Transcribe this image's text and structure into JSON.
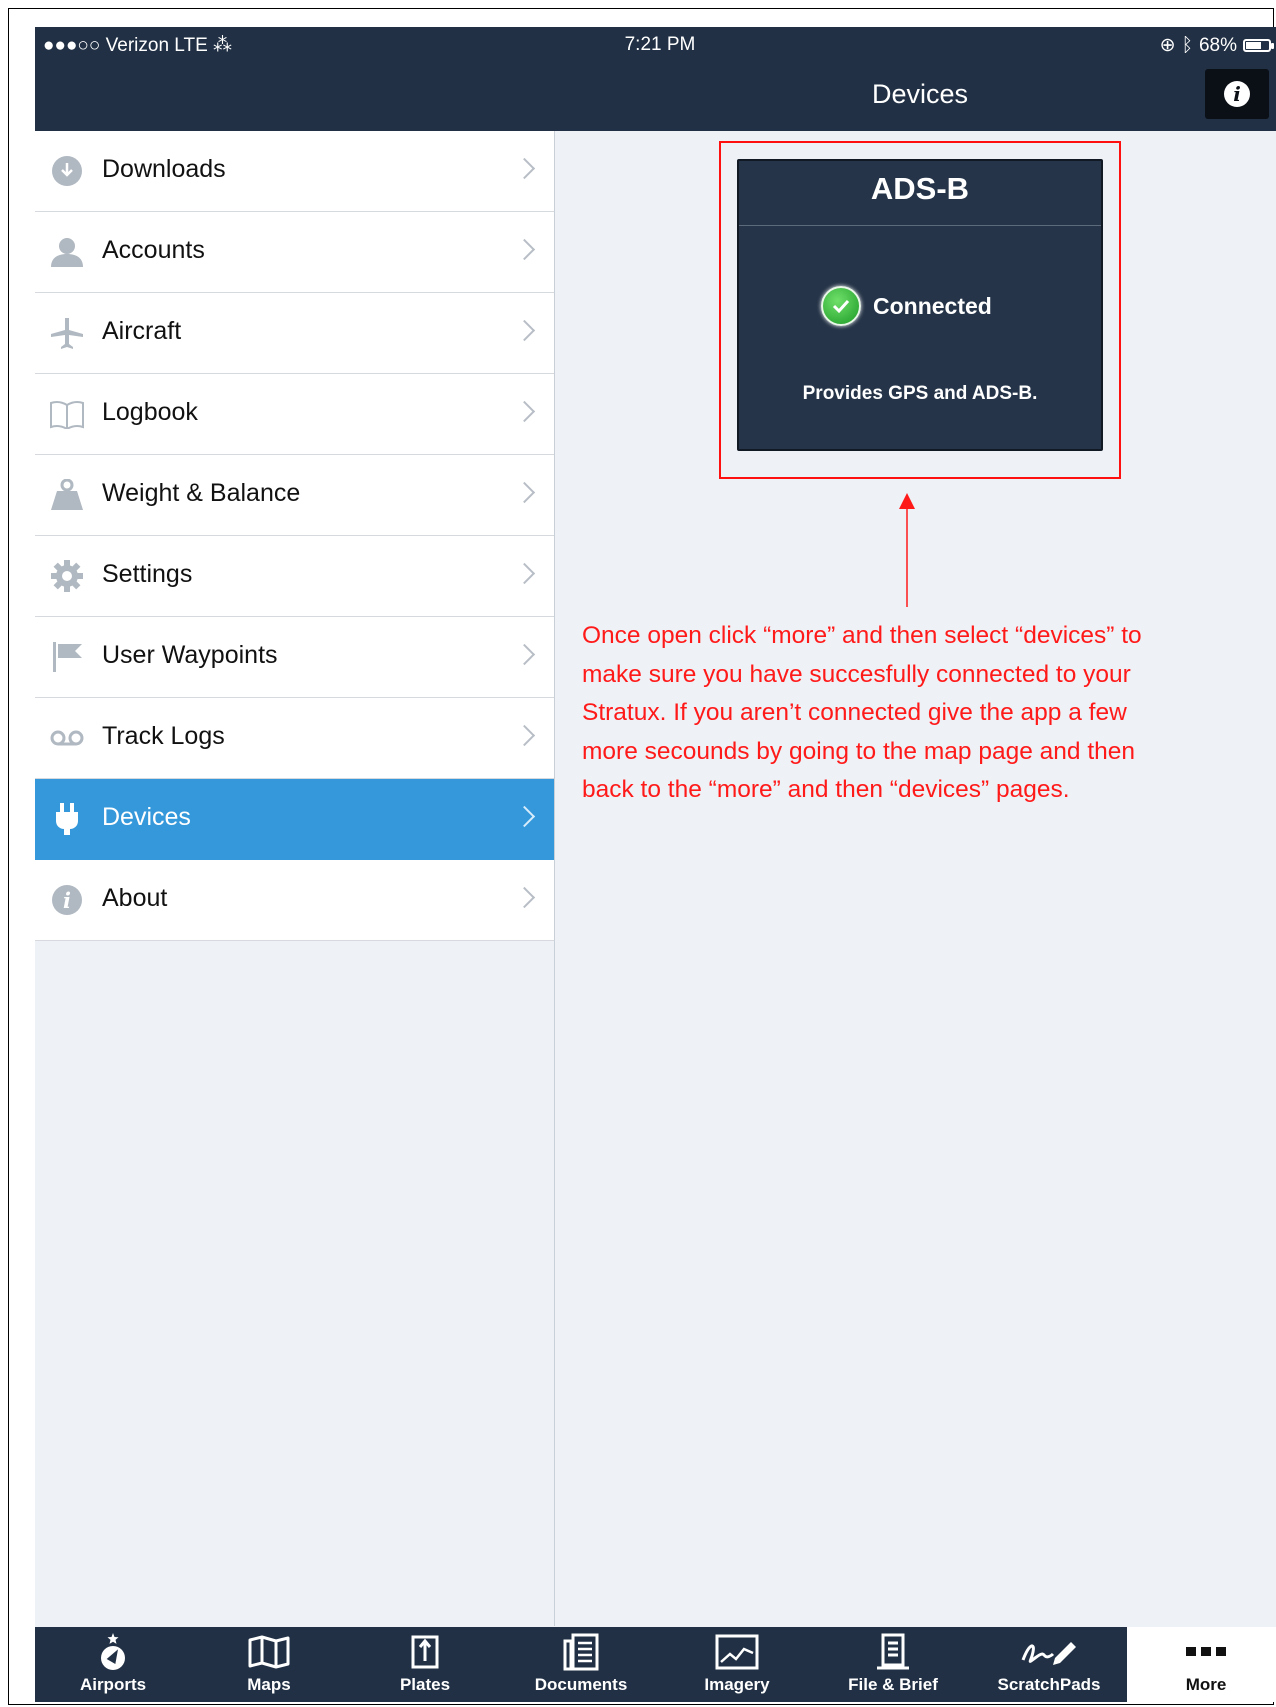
{
  "status_bar": {
    "carrier": "●●●○○ Verizon  LTE  ⁂",
    "time": "7:21 PM",
    "battery": "68%",
    "battery_level": 0.68
  },
  "nav": {
    "title": "Devices",
    "info_icon": "info-icon"
  },
  "sidebar": {
    "items": [
      {
        "label": "Downloads",
        "icon": "download-icon"
      },
      {
        "label": "Accounts",
        "icon": "person-icon"
      },
      {
        "label": "Aircraft",
        "icon": "airplane-icon"
      },
      {
        "label": "Logbook",
        "icon": "book-icon"
      },
      {
        "label": "Weight & Balance",
        "icon": "weight-icon"
      },
      {
        "label": "Settings",
        "icon": "gear-icon"
      },
      {
        "label": "User Waypoints",
        "icon": "flag-icon"
      },
      {
        "label": "Track Logs",
        "icon": "tracklog-icon"
      },
      {
        "label": "Devices",
        "icon": "plug-icon",
        "selected": true
      },
      {
        "label": "About",
        "icon": "info-icon"
      }
    ]
  },
  "device_card": {
    "title": "ADS-B",
    "status": "Connected",
    "description": "Provides GPS and ADS-B."
  },
  "annotation": {
    "text": "Once open click “more” and then select “devices” to\nmake sure you have succesfully connected to your\nStratux. If you aren’t connected give the app a few\nmore secounds by going to the map page and then\nback to the “more” and then “devices” pages.",
    "color": "#ff1a1a"
  },
  "tabbar": {
    "tabs": [
      {
        "label": "Airports",
        "icon": "airport-icon"
      },
      {
        "label": "Maps",
        "icon": "map-icon"
      },
      {
        "label": "Plates",
        "icon": "plates-icon"
      },
      {
        "label": "Documents",
        "icon": "documents-icon"
      },
      {
        "label": "Imagery",
        "icon": "imagery-icon"
      },
      {
        "label": "File & Brief",
        "icon": "file-brief-icon"
      },
      {
        "label": "ScratchPads",
        "icon": "scratchpad-icon"
      },
      {
        "label": "More",
        "icon": "more-icon",
        "selected": true
      }
    ]
  },
  "colors": {
    "nav_bg": "#213044",
    "selected_bg": "#3498db",
    "card_bg": "#253448",
    "highlight": "#ff1010"
  }
}
